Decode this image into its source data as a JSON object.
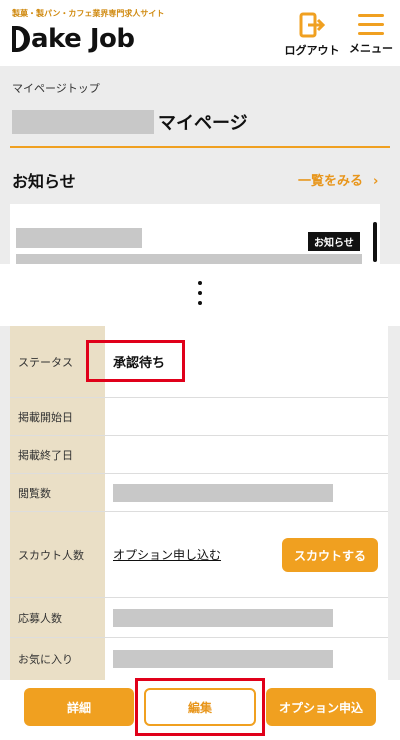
{
  "header": {
    "tagline": "製菓・製パン・カフェ業界専門求人サイト",
    "logo": "ake Job",
    "logo_initial": "B",
    "logout_label": "ログアウト",
    "menu_label": "メニュー",
    "accent": "#f0a020"
  },
  "breadcrumb": "マイページトップ",
  "page_title": "マイページ",
  "notice": {
    "heading": "お知らせ",
    "more_link": "一覧をみる",
    "more_chevron": "›",
    "badge": "お知らせ"
  },
  "table": {
    "status_label": "ステータス",
    "status_value": "承認待ち",
    "start_label": "掲載開始日",
    "end_label": "掲載終了日",
    "views_label": "閲覧数",
    "scouts_label": "スカウト人数",
    "scouts_link": "オプション申し込む",
    "scout_button": "スカウトする",
    "applicants_label": "応募人数",
    "favorites_label": "お気に入り"
  },
  "bottom": {
    "detail": "詳細",
    "edit": "編集",
    "option": "オプション申込"
  },
  "highlight_color": "#e0001a"
}
